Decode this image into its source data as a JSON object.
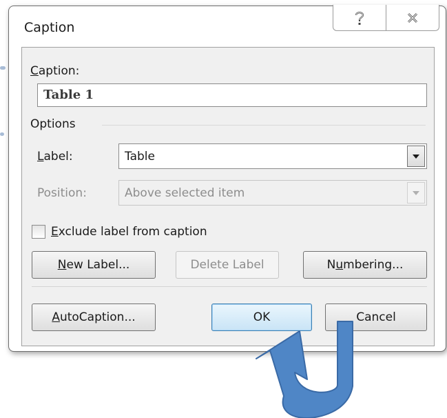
{
  "window": {
    "title": "Caption",
    "help_glyph": "?",
    "close_glyph": "✕"
  },
  "fields": {
    "caption_label_accel": "C",
    "caption_label_rest": "aption:",
    "caption_value": "Table 1",
    "options_heading": "Options",
    "label_label_accel": "L",
    "label_label_rest": "abel:",
    "label_value": "Table",
    "position_label": "Position:",
    "position_value": "Above selected item",
    "exclude_accel": "E",
    "exclude_rest": "xclude label from caption",
    "exclude_checked": false
  },
  "buttons": {
    "new_label_accel": "N",
    "new_label_rest": "ew Label...",
    "delete_label": "Delete Label",
    "numbering_pre": "N",
    "numbering_accel": "u",
    "numbering_rest": "mbering...",
    "autocaption_accel": "A",
    "autocaption_rest": "utoCaption...",
    "ok": "OK",
    "cancel": "Cancel"
  },
  "annotation": {
    "arrow_fill": "#4f86c6",
    "arrow_stroke": "#3a6aa6",
    "icon": "curved-arrow-icon"
  }
}
